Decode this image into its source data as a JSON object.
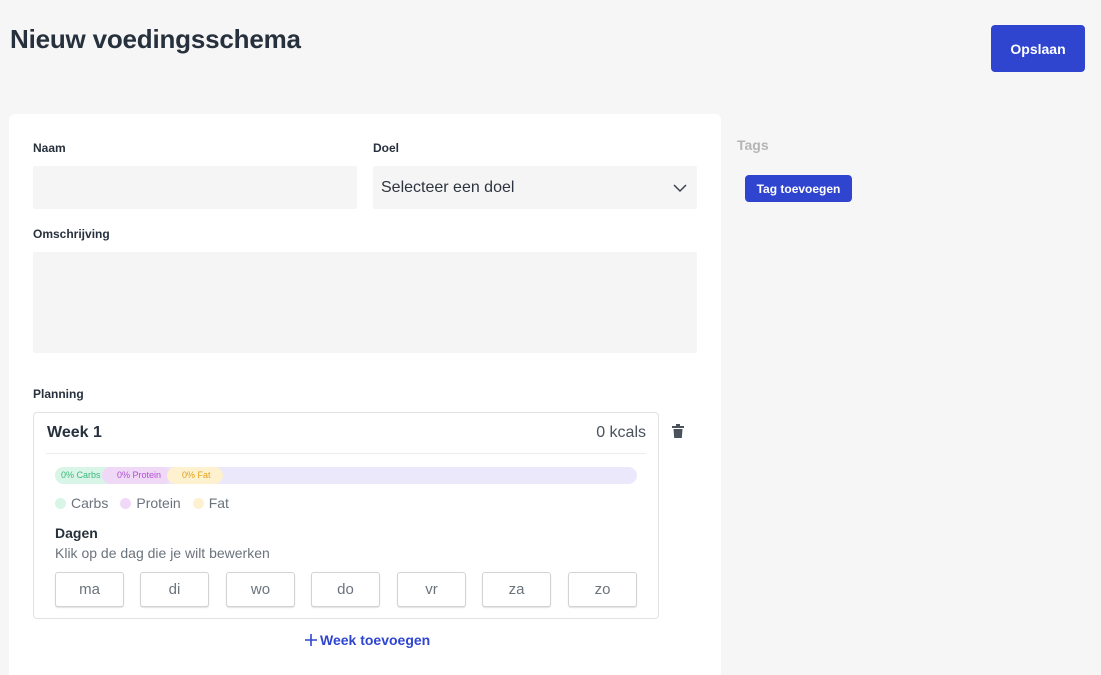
{
  "header": {
    "title": "Nieuw voedingsschema",
    "save_label": "Opslaan"
  },
  "form": {
    "name_label": "Naam",
    "name_value": "",
    "goal_label": "Doel",
    "goal_selected": "Selecteer een doel",
    "description_label": "Omschrijving",
    "description_value": "",
    "planning_label": "Planning"
  },
  "week": {
    "title": "Week 1",
    "kcal": "0 kcals",
    "macros": {
      "carbs_pill": "0% Carbs",
      "protein_pill": "0% Protein",
      "fat_pill": "0% Fat"
    },
    "legend": {
      "carbs": "Carbs",
      "protein": "Protein",
      "fat": "Fat"
    },
    "days_title": "Dagen",
    "days_hint": "Klik op de dag die je wilt bewerken",
    "days": [
      "ma",
      "di",
      "wo",
      "do",
      "vr",
      "za",
      "zo"
    ]
  },
  "add_week_label": "Week toevoegen",
  "tags": {
    "label": "Tags",
    "add_label": "Tag toevoegen"
  },
  "colors": {
    "primary": "#2f45d0",
    "carbs": "#d8f5e7",
    "protein": "#efd9f7",
    "fat": "#fdf1cf",
    "track": "#ebe8fb"
  },
  "icons": {
    "dropdown": "chevron-down-icon",
    "delete": "trash-icon",
    "add": "plus-icon"
  }
}
